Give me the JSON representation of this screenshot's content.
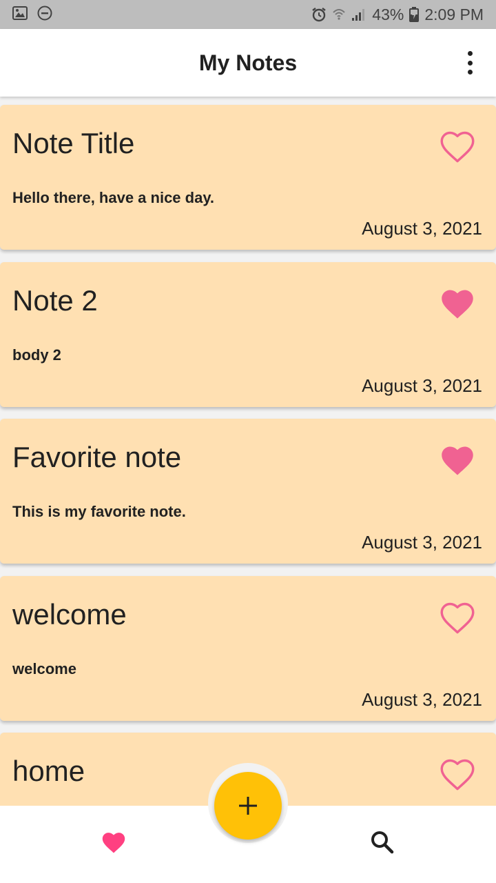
{
  "status_bar": {
    "battery": "43%",
    "time": "2:09 PM",
    "icons": [
      "image-icon",
      "do-not-disturb-icon",
      "alarm-icon",
      "wifi-icon",
      "signal-icon",
      "battery-charging-icon"
    ]
  },
  "app_bar": {
    "title": "My Notes",
    "menu_icon": "more-vert-icon"
  },
  "notes": [
    {
      "title": "Note Title",
      "body": "Hello there, have a nice day.",
      "date": "August 3, 2021",
      "favorite": false
    },
    {
      "title": "Note 2",
      "body": "body 2",
      "date": "August 3, 2021",
      "favorite": true
    },
    {
      "title": "Favorite note",
      "body": "This is my favorite note.",
      "date": "August 3, 2021",
      "favorite": true
    },
    {
      "title": "welcome",
      "body": "welcome",
      "date": "August 3, 2021",
      "favorite": false
    },
    {
      "title": "home",
      "body": "",
      "date": "",
      "favorite": false
    }
  ],
  "bottom_bar": {
    "favorites_icon": "heart-icon",
    "search_icon": "search-icon",
    "fab_icon": "plus-icon"
  },
  "colors": {
    "card_background": "#ffe0b2",
    "heart": "#f06292",
    "nav_heart": "#ff4081",
    "fab": "#ffc107",
    "status_bar": "#bdbdbd"
  }
}
